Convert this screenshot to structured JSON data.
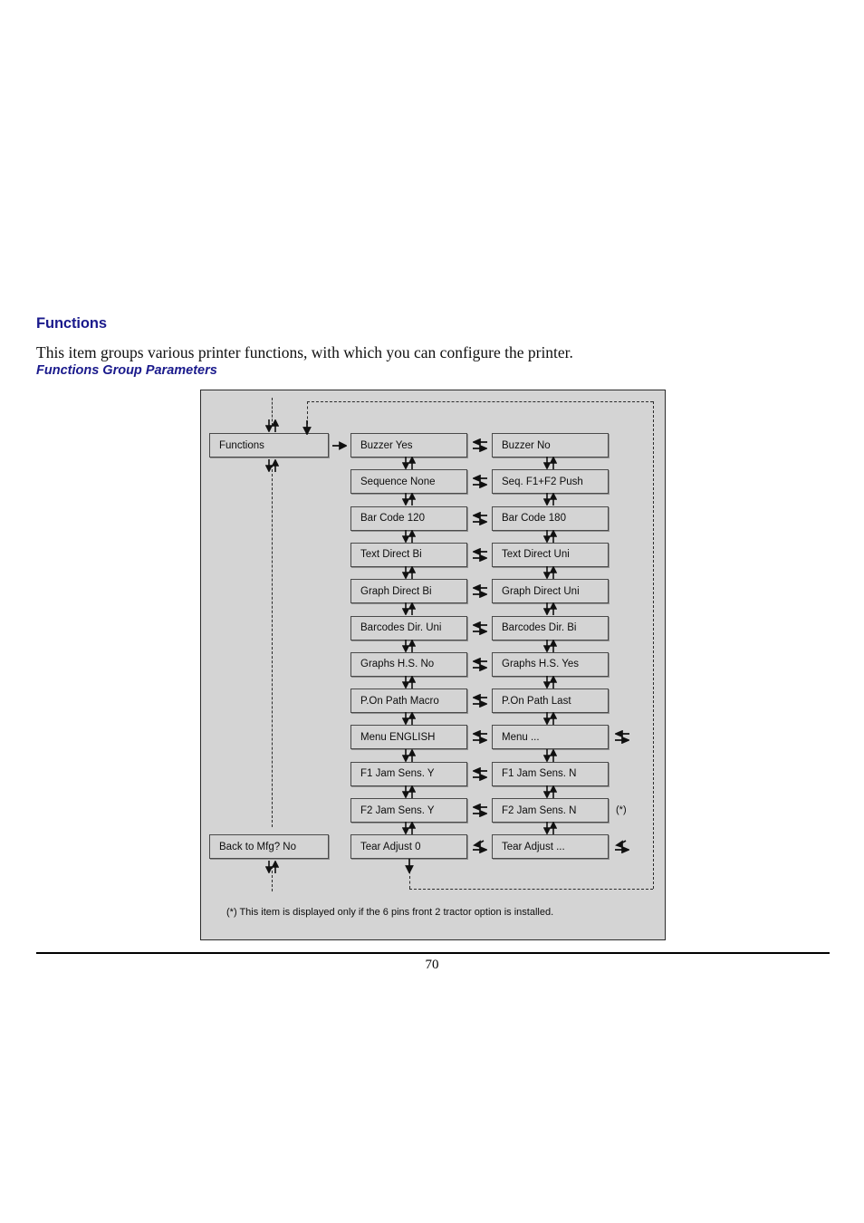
{
  "page": {
    "section_title": "Functions",
    "body_text": "This item groups various printer functions, with which you can configure the printer.",
    "figure_caption": "Functions Group Parameters",
    "page_number": "70",
    "title_color": "#1a1a8c"
  },
  "diagram": {
    "background_color": "#d4d4d4",
    "border_color": "#2b2b2b",
    "entry_node": {
      "label": "Functions"
    },
    "exit_node": {
      "label": "Back to Mfg? No"
    },
    "rows": [
      {
        "mid": "Buzzer Yes",
        "right": "Buzzer No",
        "connector": "double-horizontal",
        "extra_connector": "",
        "mark": ""
      },
      {
        "mid": "Sequence None",
        "right": "Seq.  F1+F2 Push",
        "connector": "double-horizontal",
        "extra_connector": "",
        "mark": ""
      },
      {
        "mid": "Bar Code 120",
        "right": "Bar Code 180",
        "connector": "double-horizontal",
        "extra_connector": "",
        "mark": ""
      },
      {
        "mid": "Text Direct Bi",
        "right": "Text Direct Uni",
        "connector": "double-horizontal",
        "extra_connector": "",
        "mark": ""
      },
      {
        "mid": "Graph Direct Bi",
        "right": "Graph Direct Uni",
        "connector": "double-horizontal",
        "extra_connector": "",
        "mark": ""
      },
      {
        "mid": "Barcodes Dir. Uni",
        "right": "Barcodes Dir. Bi",
        "connector": "double-horizontal",
        "extra_connector": "",
        "mark": ""
      },
      {
        "mid": "Graphs H.S. No",
        "right": "Graphs H.S. Yes",
        "connector": "double-horizontal",
        "extra_connector": "",
        "mark": ""
      },
      {
        "mid": "P.On Path Macro",
        "right": "P.On Path Last",
        "connector": "double-horizontal",
        "extra_connector": "",
        "mark": ""
      },
      {
        "mid": "Menu ENGLISH",
        "right": "Menu ...",
        "connector": "double-horizontal",
        "extra_connector": "double-horizontal",
        "mark": ""
      },
      {
        "mid": "F1 Jam Sens. Y",
        "right": "F1 Jam Sens. N",
        "connector": "double-horizontal",
        "extra_connector": "",
        "mark": ""
      },
      {
        "mid": "F2 Jam Sens. Y",
        "right": "F2 Jam Sens. N",
        "connector": "double-horizontal",
        "extra_connector": "",
        "mark": "(*)"
      },
      {
        "mid": "Tear Adjust 0",
        "right": "Tear Adjust ...",
        "connector": "bent-arrow",
        "extra_connector": "bent-arrow",
        "mark": ""
      }
    ],
    "footnote": "(*) This item is displayed only if the 6 pins front 2 tractor option is installed."
  }
}
